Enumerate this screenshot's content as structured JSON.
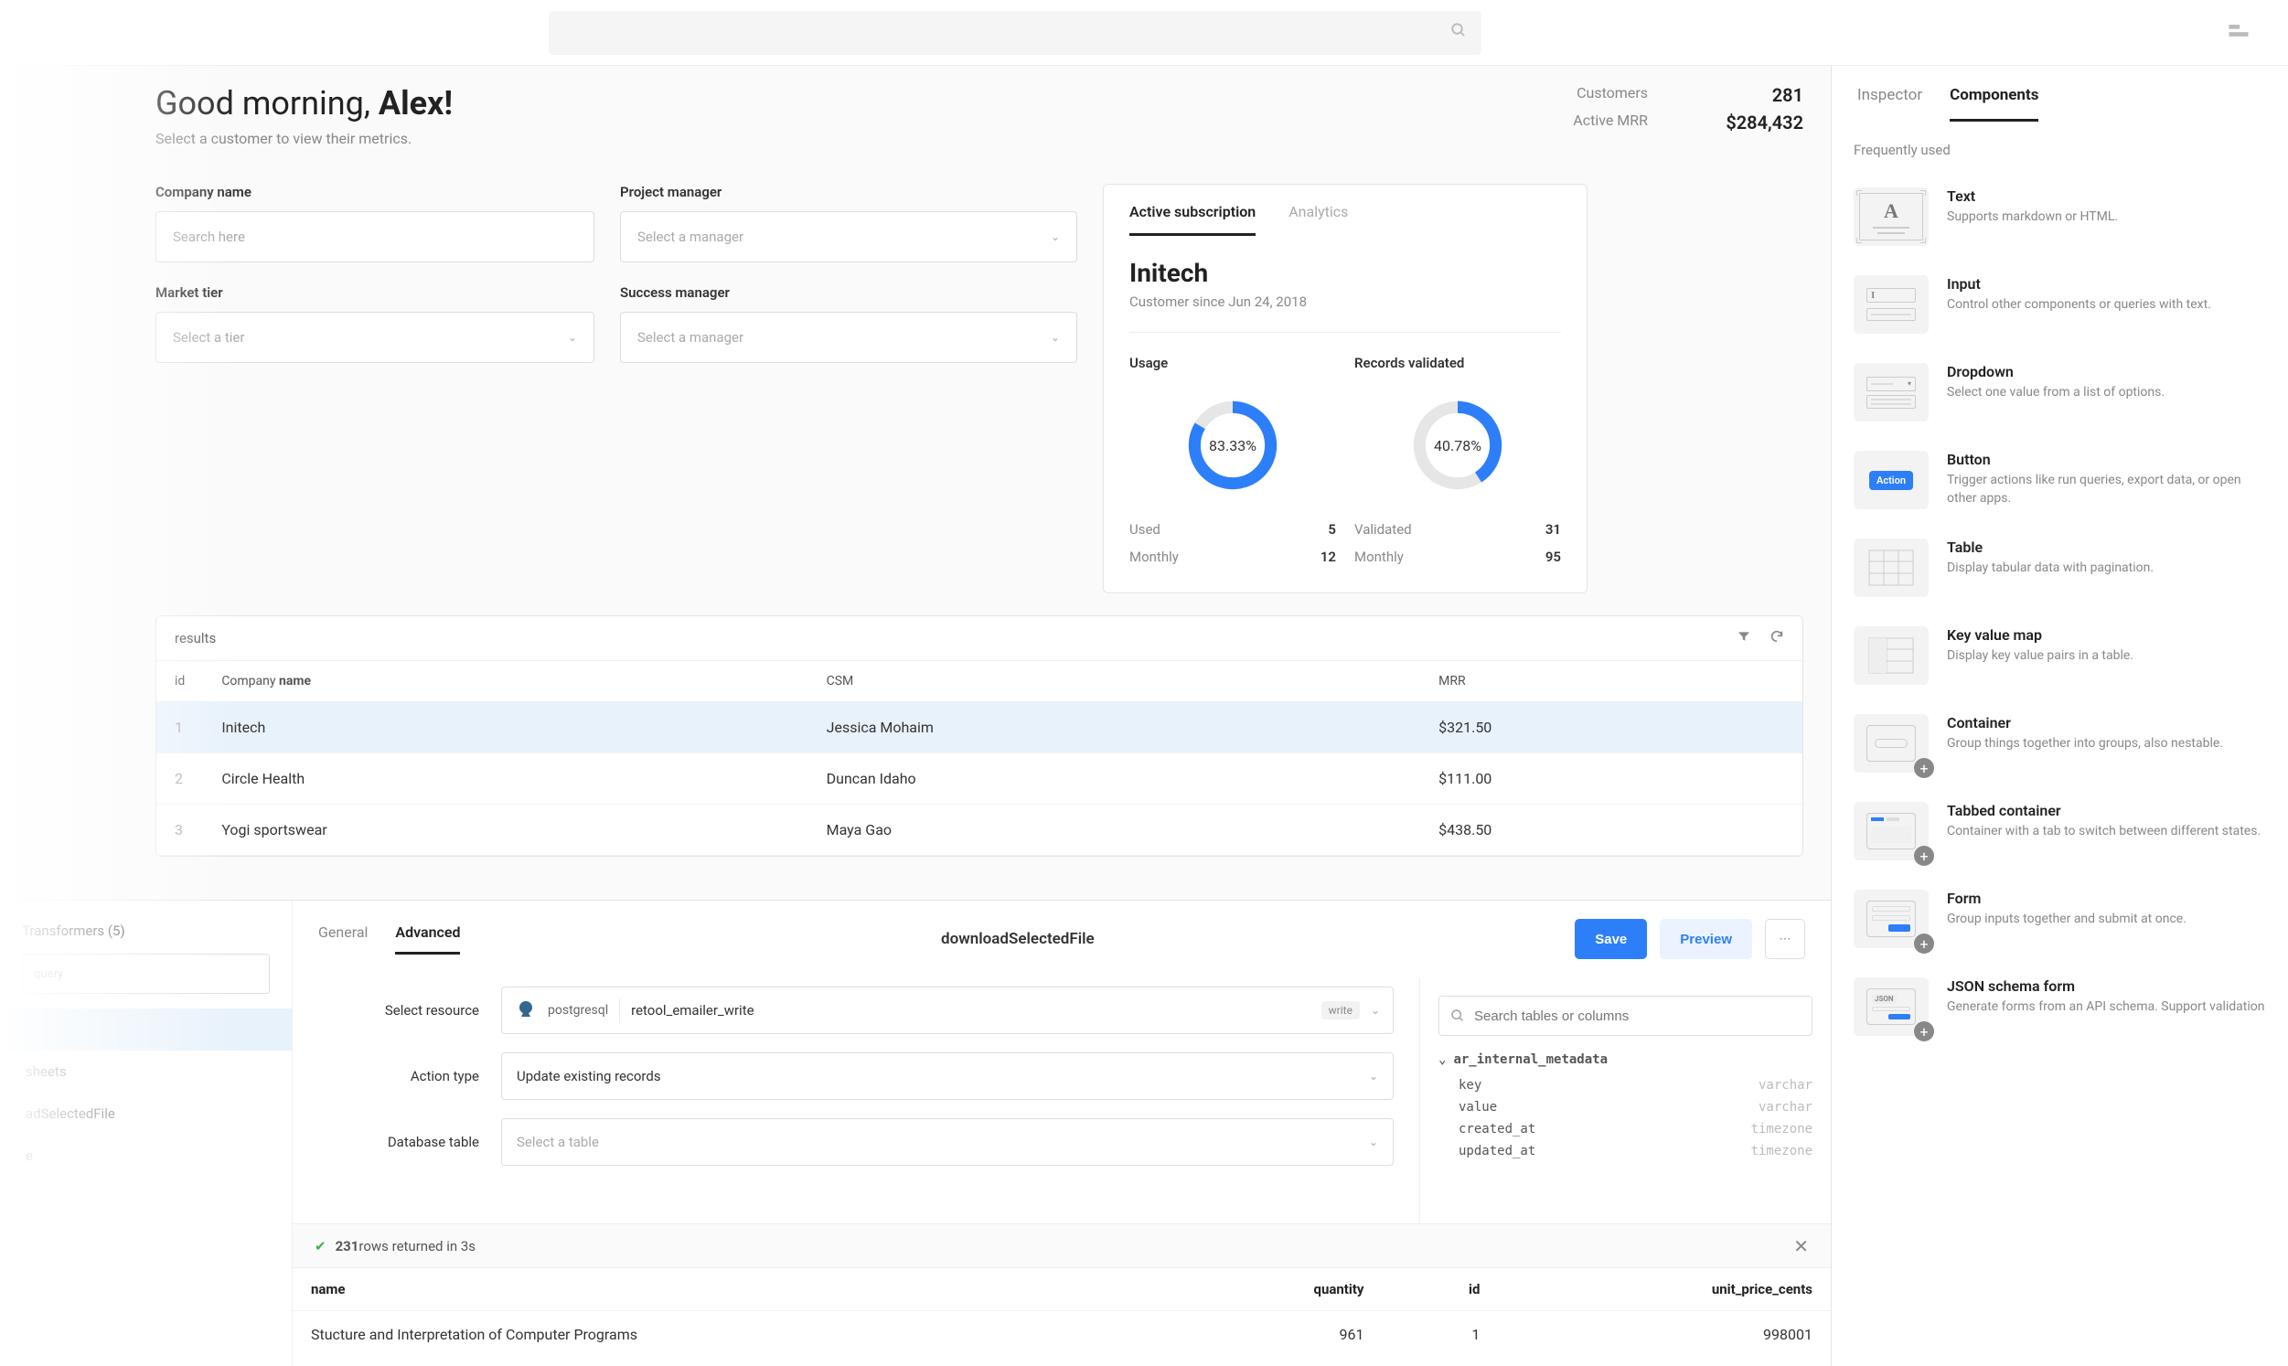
{
  "topbar": {
    "search_placeholder": ""
  },
  "greeting": {
    "line1_prefix": "Good morning, ",
    "line1_bold": "Alex!",
    "subtitle": "Select a customer to view their metrics."
  },
  "stats": {
    "customers_label": "Customers",
    "customers_value": "281",
    "mrr_label": "Active MRR",
    "mrr_value": "$284,432"
  },
  "filters": {
    "company_label": "Company name",
    "company_placeholder": "Search here",
    "tier_label": "Market tier",
    "tier_placeholder": "Select a tier",
    "pm_label": "Project manager",
    "pm_placeholder": "Select a manager",
    "sm_label": "Success manager",
    "sm_placeholder": "Select a manager"
  },
  "results": {
    "count_label": "results",
    "cols": {
      "id": "id",
      "company_pre": "Company ",
      "company_bold": "name",
      "csm": "CSM",
      "mrr": "MRR"
    },
    "rows": [
      {
        "idx": "1",
        "name": "Initech",
        "csm": "Jessica Mohaim",
        "mrr": "$321.50",
        "selected": true
      },
      {
        "idx": "2",
        "name": "Circle Health",
        "csm": "Duncan Idaho",
        "mrr": "$111.00",
        "selected": false
      },
      {
        "idx": "3",
        "name": "Yogi sportswear",
        "csm": "Maya Gao",
        "mrr": "$438.50",
        "selected": false
      }
    ]
  },
  "subscription": {
    "tabs": {
      "active": "Active subscription",
      "analytics": "Analytics"
    },
    "company": "Initech",
    "since": "Customer since Jun 24, 2018",
    "usage": {
      "title": "Usage",
      "pct": "83.33%",
      "pct_num": 83.33,
      "used_k": "Used",
      "used_v": "5",
      "monthly_k": "Monthly",
      "monthly_v": "12"
    },
    "records": {
      "title": "Records validated",
      "pct": "40.78%",
      "pct_num": 40.78,
      "validated_k": "Validated",
      "validated_v": "31",
      "monthly_k": "Monthly",
      "monthly_v": "95"
    }
  },
  "bottom": {
    "left": {
      "tab_transformers": "Transformers (5)",
      "search_placeholder": "query",
      "items": [
        "sheets",
        "adSelectedFile",
        "e"
      ]
    },
    "tabs": {
      "general": "General",
      "advanced": "Advanced"
    },
    "title": "downloadSelectedFile",
    "actions": {
      "save": "Save",
      "preview": "Preview"
    },
    "form": {
      "resource_label": "Select resource",
      "resource_db": "postgresql",
      "resource_name": "retool_emailer_write",
      "resource_mode": "write",
      "action_label": "Action type",
      "action_value": "Update existing records",
      "table_label": "Database table",
      "table_placeholder": "Select a table"
    },
    "columns": {
      "search_placeholder": "Search tables or columns",
      "tree_name": "ar_internal_metadata",
      "rows": [
        {
          "k": "key",
          "t": "varchar"
        },
        {
          "k": "value",
          "t": "varchar"
        },
        {
          "k": "created_at",
          "t": "timezone"
        },
        {
          "k": "updated_at",
          "t": "timezone"
        }
      ]
    },
    "status": {
      "count": "231",
      "suffix": " rows returned in 3s"
    },
    "grid": {
      "cols": {
        "name": "name",
        "quantity": "quantity",
        "id": "id",
        "upc": "unit_price_cents"
      },
      "row": {
        "name": "Stucture and Interpretation of Computer Programs",
        "quantity": "961",
        "id": "1",
        "upc": "998001"
      }
    }
  },
  "inspector": {
    "tabs": {
      "inspector": "Inspector",
      "components": "Components"
    },
    "section": "Frequently used",
    "items": [
      {
        "title": "Text",
        "desc": "Supports markdown or HTML.",
        "icon": "text"
      },
      {
        "title": "Input",
        "desc": "Control other components or queries with text.",
        "icon": "input"
      },
      {
        "title": "Dropdown",
        "desc": "Select one value from a list of options.",
        "icon": "dropdown"
      },
      {
        "title": "Button",
        "desc": "Trigger actions like run queries, export data, or open other apps.",
        "icon": "button"
      },
      {
        "title": "Table",
        "desc": "Display tabular data with pagination.",
        "icon": "table"
      },
      {
        "title": "Key value map",
        "desc": "Display key value pairs in a table.",
        "icon": "kvmap"
      },
      {
        "title": "Container",
        "desc": "Group things together into groups, also nestable.",
        "icon": "container"
      },
      {
        "title": "Tabbed container",
        "desc": "Container with a tab to switch between different states.",
        "icon": "tabbed"
      },
      {
        "title": "Form",
        "desc": "Group inputs together and submit at once.",
        "icon": "form"
      },
      {
        "title": "JSON schema form",
        "desc": "Generate forms from an API schema. Support validation",
        "icon": "json"
      }
    ]
  }
}
